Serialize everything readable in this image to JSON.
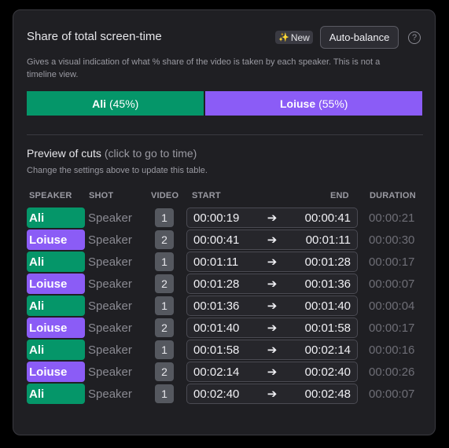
{
  "share": {
    "title": "Share of total screen-time",
    "new_badge": "New",
    "auto_balance": "Auto-balance",
    "help_glyph": "?",
    "description": "Gives a visual indication of what % share of the video is taken by each speaker. This is not a timeline view.",
    "segments": [
      {
        "name": "Ali",
        "pct_label": "(45%)",
        "share": 0.45,
        "color": "#059669"
      },
      {
        "name": "Loiuse",
        "pct_label": "(55%)",
        "share": 0.55,
        "color": "#8b5cf6"
      }
    ]
  },
  "preview": {
    "title": "Preview of cuts",
    "title_hint": "(click to go to time)",
    "subtitle": "Change the settings above to update this table.",
    "headers": {
      "speaker": "SPEAKER",
      "shot": "SHOT",
      "video": "VIDEO",
      "start": "START",
      "end": "END",
      "duration": "DURATION"
    },
    "arrow": "➔",
    "rows": [
      {
        "speaker": "Ali",
        "shot": "Speaker",
        "video": "1",
        "start": "00:00:19",
        "end": "00:00:41",
        "duration": "00:00:21"
      },
      {
        "speaker": "Loiuse",
        "shot": "Speaker",
        "video": "2",
        "start": "00:00:41",
        "end": "00:01:11",
        "duration": "00:00:30"
      },
      {
        "speaker": "Ali",
        "shot": "Speaker",
        "video": "1",
        "start": "00:01:11",
        "end": "00:01:28",
        "duration": "00:00:17"
      },
      {
        "speaker": "Loiuse",
        "shot": "Speaker",
        "video": "2",
        "start": "00:01:28",
        "end": "00:01:36",
        "duration": "00:00:07"
      },
      {
        "speaker": "Ali",
        "shot": "Speaker",
        "video": "1",
        "start": "00:01:36",
        "end": "00:01:40",
        "duration": "00:00:04"
      },
      {
        "speaker": "Loiuse",
        "shot": "Speaker",
        "video": "2",
        "start": "00:01:40",
        "end": "00:01:58",
        "duration": "00:00:17"
      },
      {
        "speaker": "Ali",
        "shot": "Speaker",
        "video": "1",
        "start": "00:01:58",
        "end": "00:02:14",
        "duration": "00:00:16"
      },
      {
        "speaker": "Loiuse",
        "shot": "Speaker",
        "video": "2",
        "start": "00:02:14",
        "end": "00:02:40",
        "duration": "00:00:26"
      },
      {
        "speaker": "Ali",
        "shot": "Speaker",
        "video": "1",
        "start": "00:02:40",
        "end": "00:02:48",
        "duration": "00:00:07"
      }
    ]
  },
  "colors": {
    "Ali": "#059669",
    "Loiuse": "#8b5cf6"
  }
}
